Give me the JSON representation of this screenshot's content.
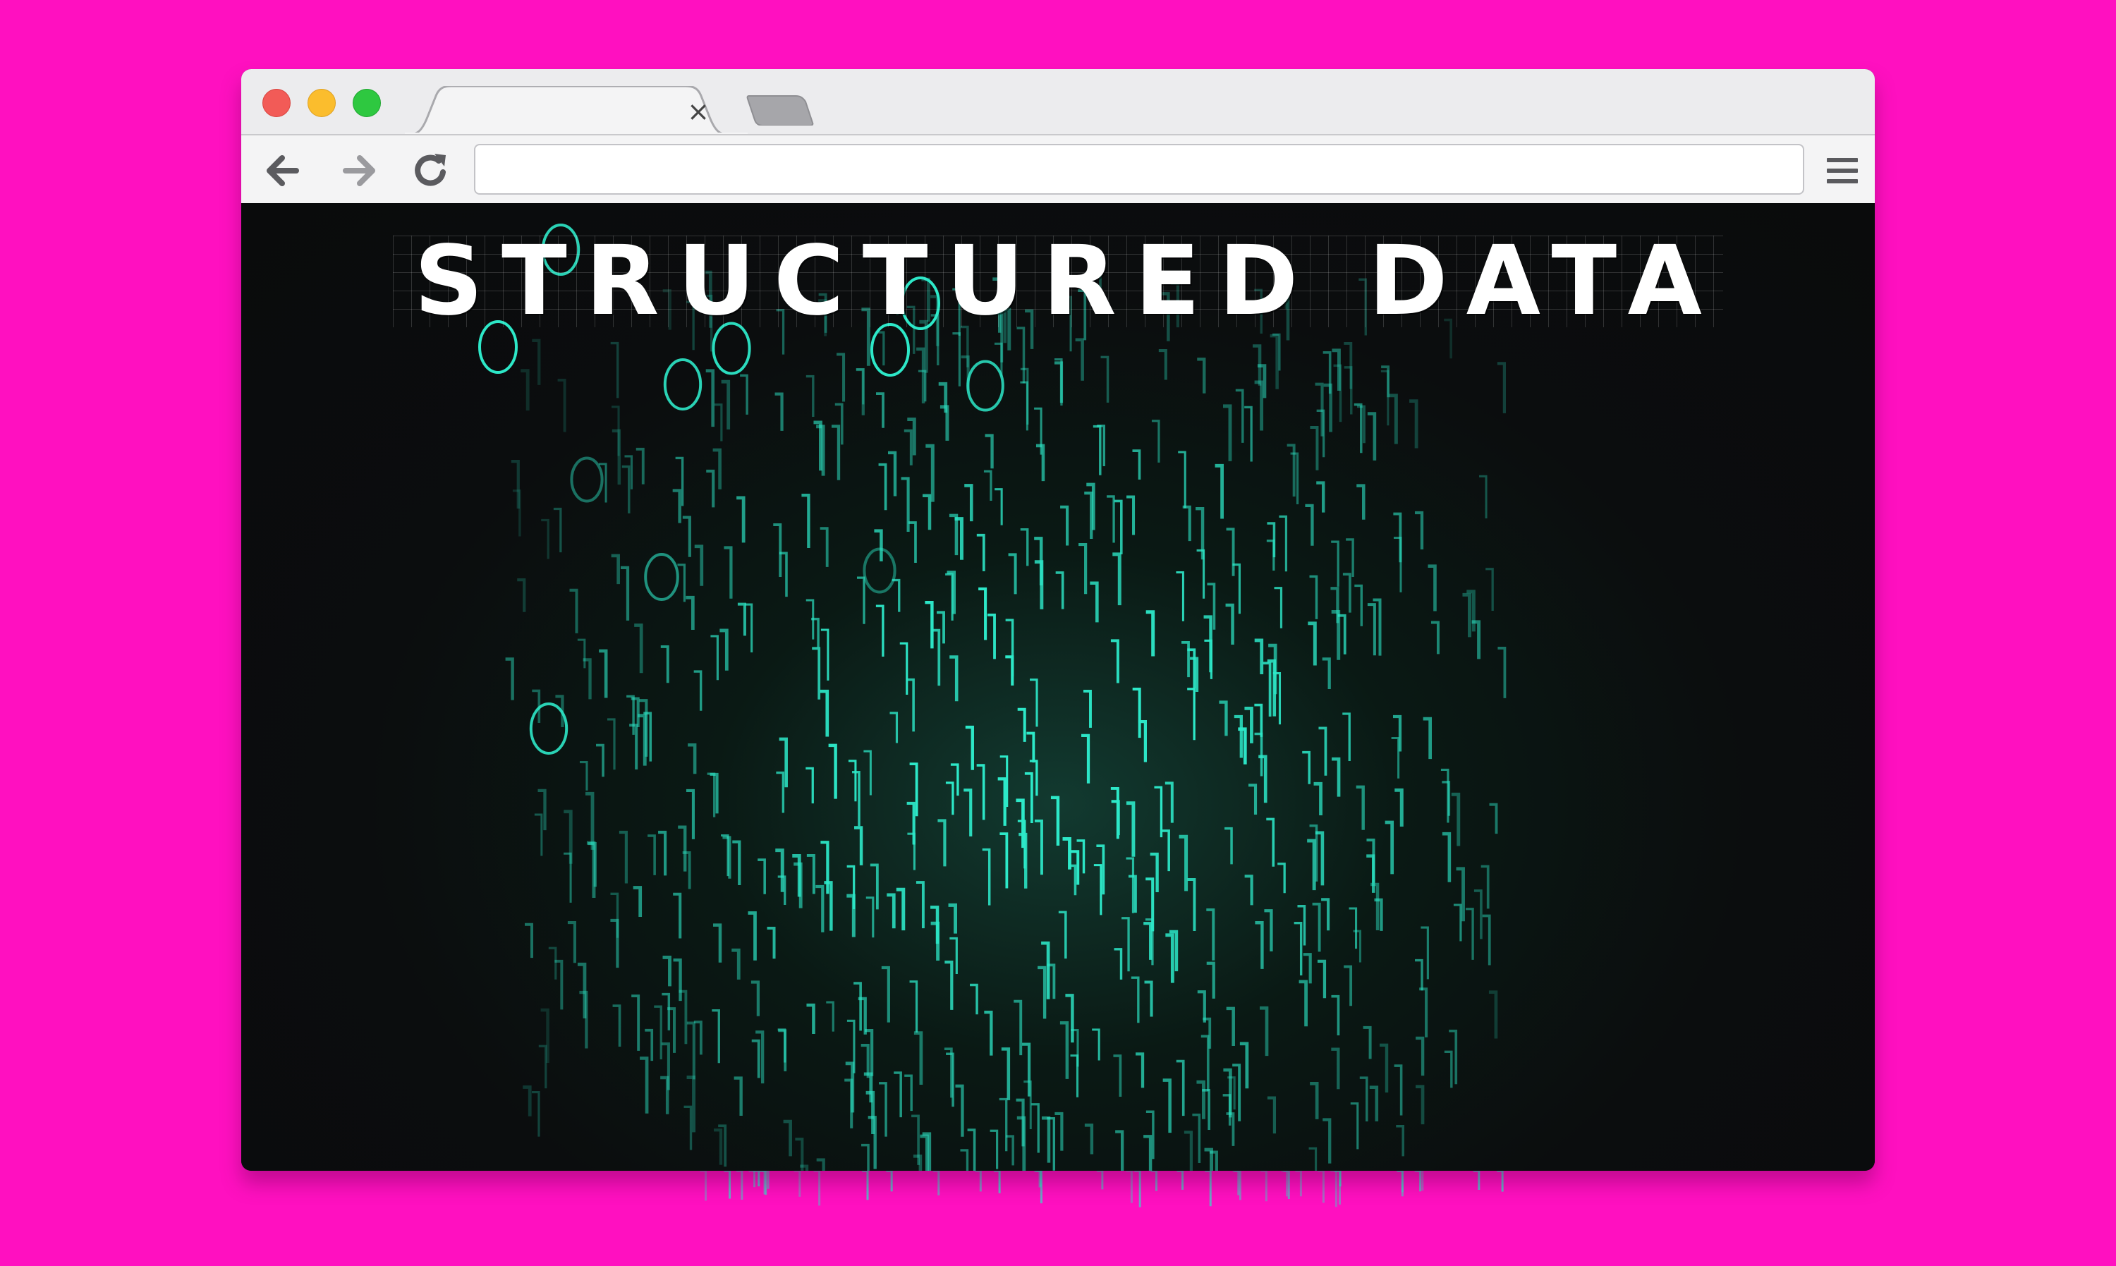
{
  "browser": {
    "tab": {
      "close_glyph": "×"
    },
    "address_bar": {
      "value": "",
      "placeholder": ""
    },
    "toolbar": {
      "back_icon": "arrow-left-icon",
      "forward_icon": "arrow-right-icon",
      "reload_icon": "reload-icon",
      "menu_icon": "hamburger-menu-icon"
    },
    "window_controls": [
      "close",
      "minimize",
      "maximize"
    ]
  },
  "hero": {
    "title": "STRUCTURED DATA"
  },
  "colors": {
    "background": "#ff10c0",
    "rain": "#2de8c8",
    "viewport": "#0b0c0e"
  }
}
